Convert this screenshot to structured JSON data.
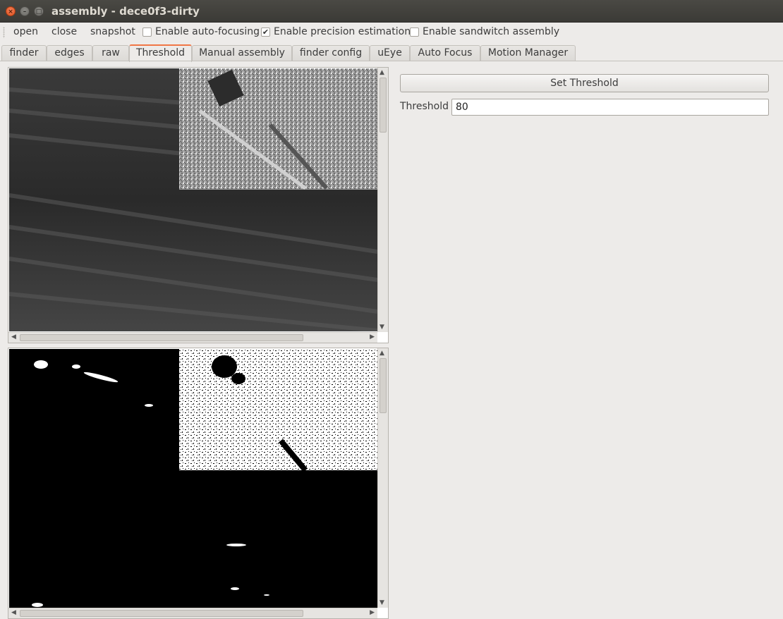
{
  "window": {
    "title": "assembly - dece0f3-dirty"
  },
  "toolbar": {
    "open": "open",
    "close": "close",
    "snapshot": "snapshot",
    "autofocus_label": "Enable auto-focusing",
    "autofocus_checked": false,
    "precision_label": "Enable precision estimation",
    "precision_checked": true,
    "sandwich_label": "Enable sandwitch assembly",
    "sandwich_checked": false
  },
  "tabs": [
    {
      "label": "finder"
    },
    {
      "label": "edges"
    },
    {
      "label": "raw"
    },
    {
      "label": "Threshold",
      "active": true
    },
    {
      "label": "Manual assembly"
    },
    {
      "label": "finder config"
    },
    {
      "label": "uEye"
    },
    {
      "label": "Auto Focus"
    },
    {
      "label": "Motion Manager"
    }
  ],
  "threshold_panel": {
    "button_label": "Set Threshold",
    "field_label": "Threshold",
    "field_value": "80"
  },
  "colors": {
    "accent_tab": "#f07746",
    "titlebar": "#3c3b37"
  }
}
